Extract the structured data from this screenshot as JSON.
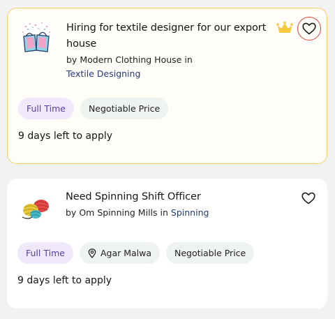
{
  "jobs": [
    {
      "title": "Hiring for textile designer for our export house",
      "by_prefix": "by",
      "company": "Modern Clothing House",
      "in_word": "in",
      "category": "Textile Designing",
      "tags": [
        "Full Time",
        "Negotiable Price"
      ],
      "deadline": "9 days left to apply",
      "featured": true,
      "icons": {
        "logo": "fabric-bags-logo",
        "badge": "crown-icon",
        "save": "heart-icon"
      }
    },
    {
      "title": "Need Spinning Shift Officer",
      "by_prefix": "by",
      "company": "Om Spinning Mills",
      "in_word": "in",
      "category": "Spinning",
      "tags": [
        "Full Time",
        "Agar Malwa",
        "Negotiable Price"
      ],
      "deadline": "9 days left to apply",
      "featured": false,
      "icons": {
        "logo": "yarn-spools-logo",
        "location": "location-pin-icon",
        "save": "heart-icon"
      }
    }
  ],
  "colors": {
    "featured_border": "#f7cf6b",
    "crown": "#f6c93e",
    "heart_ring": "#e0443a",
    "tag_purple_bg": "#efe9fb",
    "tag_grey_bg": "#eef3f2",
    "category_link": "#243a7a"
  }
}
